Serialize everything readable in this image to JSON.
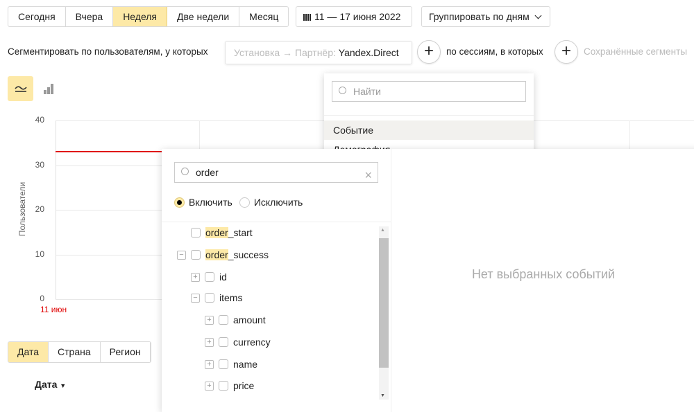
{
  "period_buttons": [
    {
      "label": "Сегодня"
    },
    {
      "label": "Вчера"
    },
    {
      "label": "Неделя",
      "active": true
    },
    {
      "label": "Две недели"
    },
    {
      "label": "Месяц"
    }
  ],
  "date_range": {
    "icon": "calendar-icon",
    "label": "11 — 17 июня 2022"
  },
  "group_by": {
    "label": "Группировать по дням",
    "icon": "chevron-down-icon"
  },
  "segment": {
    "users_label": "Сегментировать по пользователям, у которых",
    "condition_prefix": "Установка → Партнёр:",
    "condition_value": "Yandex.Direct",
    "sessions_label": "по сессиям, в которых",
    "saved_segments": "Сохранённые сегменты"
  },
  "chart_modes": [
    {
      "icon": "line-chart-icon",
      "active": true
    },
    {
      "icon": "bar-chart-icon"
    }
  ],
  "chart_data": {
    "type": "line",
    "ylabel": "Пользователи",
    "ylim": [
      0,
      40
    ],
    "yticks": [
      "0",
      "10",
      "20",
      "30",
      "40"
    ],
    "x": [
      "11 июн"
    ],
    "series": [
      {
        "values": [
          33
        ],
        "color": "#e00000"
      }
    ],
    "grid": true
  },
  "filter_dropdown": {
    "search_placeholder": "Найти",
    "items": [
      {
        "label": "Событие",
        "active": true
      },
      {
        "label": "Демография"
      }
    ]
  },
  "event_panel": {
    "search_value": "order",
    "radio": [
      {
        "label": "Включить",
        "checked": true
      },
      {
        "label": "Исключить",
        "checked": false
      }
    ],
    "empty_text": "Нет выбранных событий",
    "tree": [
      {
        "match": "order",
        "rest": "_start",
        "level": 0,
        "toggle": ""
      },
      {
        "match": "order",
        "rest": "_success",
        "level": 0,
        "toggle": "−"
      },
      {
        "match": "",
        "rest": "id",
        "level": 1,
        "toggle": "+"
      },
      {
        "match": "",
        "rest": "items",
        "level": 1,
        "toggle": "−"
      },
      {
        "match": "",
        "rest": "amount",
        "level": 2,
        "toggle": "+"
      },
      {
        "match": "",
        "rest": "currency",
        "level": 2,
        "toggle": "+"
      },
      {
        "match": "",
        "rest": "name",
        "level": 2,
        "toggle": "+"
      },
      {
        "match": "",
        "rest": "price",
        "level": 2,
        "toggle": "+"
      }
    ]
  },
  "table_tabs": [
    {
      "label": "Дата",
      "active": true
    },
    {
      "label": "Страна"
    },
    {
      "label": "Регион"
    }
  ],
  "table": {
    "column_header": "Дата"
  }
}
